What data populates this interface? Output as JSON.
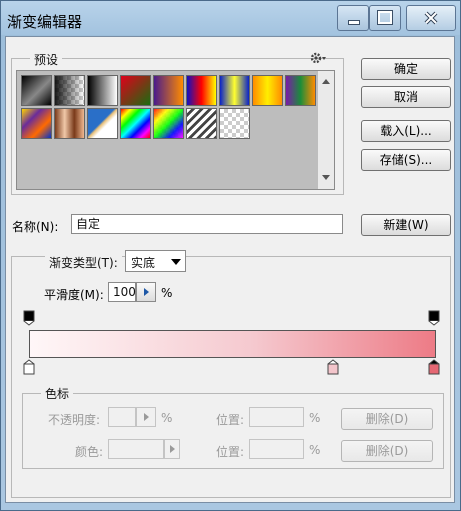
{
  "window": {
    "title": "渐变编辑器"
  },
  "buttons": {
    "ok": "确定",
    "cancel": "取消",
    "load": "载入(L)...",
    "save": "存储(S)...",
    "new": "新建(W)"
  },
  "presets": {
    "label": "预设"
  },
  "name": {
    "label": "名称(N):",
    "value": "自定"
  },
  "gradient": {
    "type_label": "渐变类型(T):",
    "type_value": "实底",
    "smoothness_label": "平滑度(M):",
    "smoothness_value": "100",
    "smoothness_unit": "%"
  },
  "color_stops": {
    "group_label": "色标",
    "opacity_label": "不透明度:",
    "percent": "%",
    "location_label": "位置:",
    "delete_label": "删除(D)",
    "color_label": "颜色:"
  },
  "colors": {
    "gradient_start": "#fff7f8",
    "gradient_end": "#ed7b86",
    "title_bar": "#a3c3df"
  }
}
